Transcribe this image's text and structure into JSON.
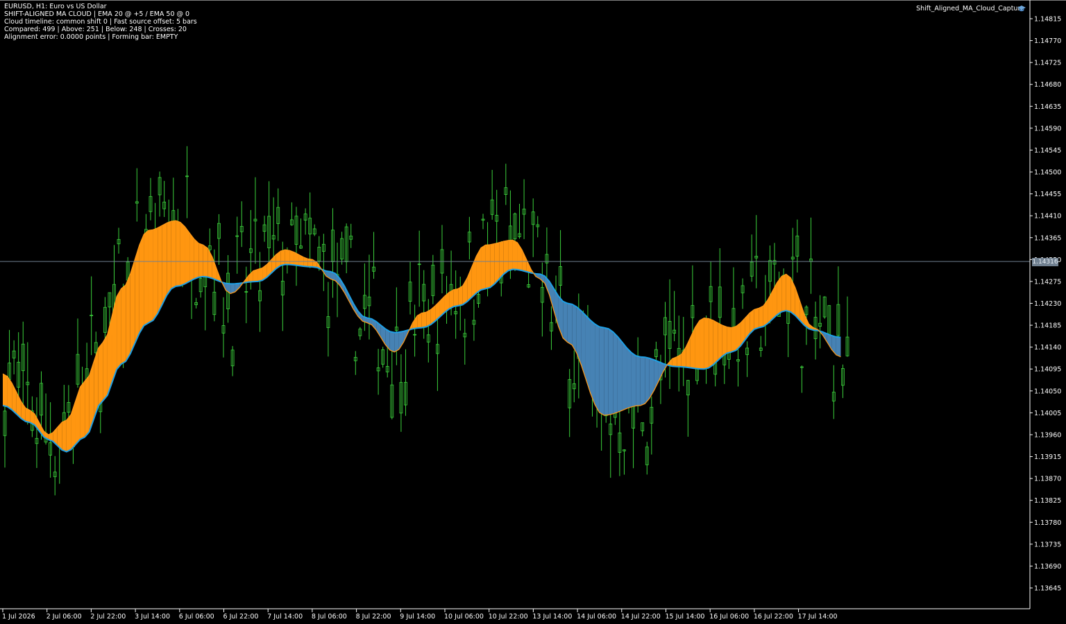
{
  "header": {
    "line1": "EURUSD, H1:  Euro vs US Dollar",
    "line2": "SHIFT-ALIGNED MA CLOUD | EMA 20 @ +5 / EMA 50 @ 0",
    "line3": "Cloud timeline: common shift 0 | Fast source offset: 5 bars",
    "line4": "Compared: 499 | Above: 251 | Below: 248 | Crosses: 20",
    "line5": "Alignment error: 0.0000 points | Forming bar: EMPTY"
  },
  "indicator_label": "Shift_Aligned_MA_Cloud_Capture",
  "current_price_label": "1.14316",
  "colors": {
    "background": "#000000",
    "candles": "#3cd23c",
    "cloud_above": "#ff9610",
    "cloud_below": "#4682b4",
    "slow_line": "#1ea0e6",
    "fast_line": "#ff9a1a",
    "price_line": "#708090",
    "axis": "#ffffff"
  },
  "chart_data": {
    "type": "line",
    "symbol": "EURUSD",
    "timeframe": "H1",
    "ylim": [
      1.136,
      1.1485
    ],
    "y_ticks": [
      "1.14815",
      "1.14770",
      "1.14725",
      "1.14680",
      "1.14635",
      "1.14590",
      "1.14545",
      "1.14500",
      "1.14455",
      "1.14410",
      "1.14365",
      "1.14320",
      "1.14275",
      "1.14230",
      "1.14185",
      "1.14140",
      "1.14095",
      "1.14050",
      "1.14005",
      "1.13960",
      "1.13915",
      "1.13870",
      "1.13825",
      "1.13780",
      "1.13735",
      "1.13690",
      "1.13645"
    ],
    "x_ticks": [
      "1 Jul 2026",
      "2 Jul 06:00",
      "2 Jul 22:00",
      "3 Jul 14:00",
      "6 Jul 06:00",
      "6 Jul 22:00",
      "7 Jul 14:00",
      "8 Jul 06:00",
      "8 Jul 22:00",
      "9 Jul 14:00",
      "10 Jul 06:00",
      "10 Jul 22:00",
      "13 Jul 14:00",
      "14 Jul 06:00",
      "14 Jul 22:00",
      "15 Jul 14:00",
      "16 Jul 06:00",
      "16 Jul 22:00",
      "17 Jul 14:00"
    ],
    "current_price": 1.14316,
    "cloud_bars": 185,
    "candle_bars": 186,
    "series": [
      {
        "name": "EMA 50 @ 0",
        "anchors": [
          [
            0,
            1.1402
          ],
          [
            6,
            1.13985
          ],
          [
            10,
            1.1395
          ],
          [
            14,
            1.13925
          ],
          [
            18,
            1.13955
          ],
          [
            22,
            1.1403
          ],
          [
            26,
            1.14105
          ],
          [
            32,
            1.1419
          ],
          [
            38,
            1.14265
          ],
          [
            44,
            1.14285
          ],
          [
            50,
            1.1427
          ],
          [
            56,
            1.14275
          ],
          [
            62,
            1.1431
          ],
          [
            68,
            1.14305
          ],
          [
            72,
            1.14295
          ],
          [
            80,
            1.142
          ],
          [
            86,
            1.1417
          ],
          [
            92,
            1.1418
          ],
          [
            100,
            1.14225
          ],
          [
            106,
            1.1426
          ],
          [
            112,
            1.143
          ],
          [
            118,
            1.1429
          ],
          [
            124,
            1.1423
          ],
          [
            132,
            1.1418
          ],
          [
            140,
            1.1412
          ],
          [
            148,
            1.141
          ],
          [
            154,
            1.14095
          ],
          [
            160,
            1.1413
          ],
          [
            166,
            1.1418
          ],
          [
            172,
            1.14215
          ],
          [
            178,
            1.14175
          ],
          [
            184,
            1.1416
          ]
        ]
      },
      {
        "name": "EMA 20 @ +5",
        "anchors": [
          [
            0,
            1.14085
          ],
          [
            6,
            1.1401
          ],
          [
            10,
            1.1396
          ],
          [
            14,
            1.1399
          ],
          [
            18,
            1.1407
          ],
          [
            22,
            1.1415
          ],
          [
            26,
            1.1426
          ],
          [
            32,
            1.1438
          ],
          [
            38,
            1.144
          ],
          [
            44,
            1.1435
          ],
          [
            50,
            1.1425
          ],
          [
            56,
            1.143
          ],
          [
            62,
            1.1434
          ],
          [
            68,
            1.1432
          ],
          [
            72,
            1.1428
          ],
          [
            80,
            1.1419
          ],
          [
            86,
            1.1413
          ],
          [
            92,
            1.1421
          ],
          [
            100,
            1.1426
          ],
          [
            106,
            1.1435
          ],
          [
            112,
            1.1436
          ],
          [
            118,
            1.1428
          ],
          [
            124,
            1.1415
          ],
          [
            132,
            1.14
          ],
          [
            140,
            1.1402
          ],
          [
            148,
            1.1412
          ],
          [
            154,
            1.142
          ],
          [
            160,
            1.1418
          ],
          [
            166,
            1.1422
          ],
          [
            172,
            1.1429
          ],
          [
            178,
            1.1418
          ],
          [
            184,
            1.1412
          ]
        ]
      }
    ]
  }
}
